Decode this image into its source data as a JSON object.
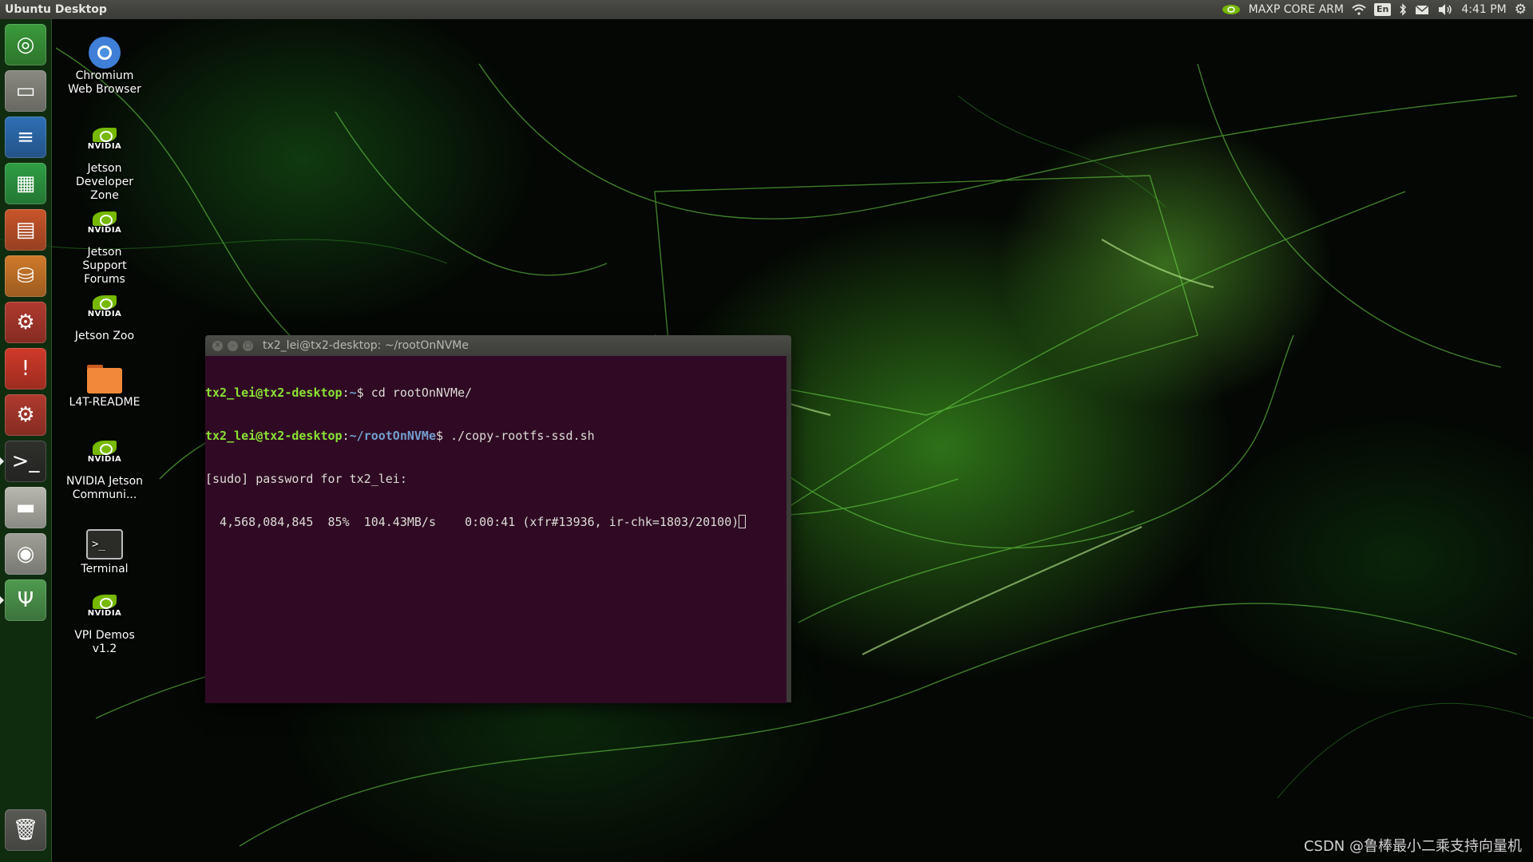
{
  "top_panel": {
    "title": "Ubuntu Desktop",
    "power_mode": "MAXP CORE ARM",
    "keyboard_lang": "En",
    "time": "4:41 PM",
    "icons": [
      "nvidia-icon",
      "wifi-icon",
      "keyboard-icon",
      "bluetooth-icon",
      "mail-icon",
      "volume-icon",
      "settings-gear-icon"
    ]
  },
  "launcher": {
    "items": [
      {
        "name": "ubuntu-dash",
        "glyph": "◎",
        "color": "#3b9b3b",
        "pip": false
      },
      {
        "name": "files",
        "glyph": "▭",
        "color": "#8a8a82",
        "pip": false
      },
      {
        "name": "libreoffice-writer",
        "glyph": "≡",
        "color": "#2e6fb5",
        "pip": false
      },
      {
        "name": "libreoffice-calc",
        "glyph": "▦",
        "color": "#2f9e44",
        "pip": false
      },
      {
        "name": "libreoffice-impress",
        "glyph": "▤",
        "color": "#c8552b",
        "pip": false
      },
      {
        "name": "software-center",
        "glyph": "⛁",
        "color": "#d07a2a",
        "pip": false
      },
      {
        "name": "system-settings",
        "glyph": "⚙",
        "color": "#b03a2e",
        "pip": false
      },
      {
        "name": "software-updater",
        "glyph": "!",
        "color": "#d03a2a",
        "pip": false
      },
      {
        "name": "system-settings-2",
        "glyph": "⚙",
        "color": "#b03a2e",
        "pip": false
      },
      {
        "name": "terminal",
        "glyph": ">_",
        "color": "#2f2f2c",
        "pip": true
      },
      {
        "name": "removable-drive",
        "glyph": "▬",
        "color": "#b8b8b0",
        "pip": false
      },
      {
        "name": "hard-drive",
        "glyph": "◉",
        "color": "#a0a098",
        "pip": false
      },
      {
        "name": "usb-drive",
        "glyph": "Ψ",
        "color": "#4f9a4f",
        "pip": true
      },
      {
        "name": "trash",
        "glyph": "🗑",
        "color": "#5a5a55",
        "pip": false
      }
    ]
  },
  "desktop": {
    "icons": [
      {
        "name": "chromium",
        "label": "Chromium Web Browser"
      },
      {
        "name": "jetson-developer-zone",
        "label": "Jetson Developer Zone"
      },
      {
        "name": "jetson-support-forums",
        "label": "Jetson Support Forums"
      },
      {
        "name": "jetson-zoo",
        "label": "Jetson Zoo"
      },
      {
        "name": "l4t-readme",
        "label": "L4T-README"
      },
      {
        "name": "nvidia-jetson-community",
        "label": "NVIDIA Jetson Communi..."
      },
      {
        "name": "terminal",
        "label": "Terminal"
      },
      {
        "name": "vpi-demos",
        "label": "VPI Demos v1.2"
      }
    ],
    "nvidia_word": "NVIDIA"
  },
  "terminal": {
    "title": "tx2_lei@tx2-desktop: ~/rootOnNVMe",
    "lines": [
      {
        "user": "tx2_lei@tx2-desktop",
        "path": "~",
        "prompt": "$ ",
        "cmd": "cd rootOnNVMe/"
      },
      {
        "user": "tx2_lei@tx2-desktop",
        "path": "~/rootOnNVMe",
        "prompt": "$ ",
        "cmd": "./copy-rootfs-ssd.sh"
      },
      {
        "text": "[sudo] password for tx2_lei:"
      },
      {
        "text": "  4,568,084,845  85%  104.43MB/s    0:00:41 (xfr#13936, ir-chk=1803/20100)"
      }
    ]
  },
  "watermark": "CSDN @鲁棒最小二乘支持向量机",
  "colors": {
    "terminal_bg": "#300a24",
    "prompt_user": "#8ae234",
    "prompt_path": "#729fcf",
    "nvidia_green": "#76b900"
  }
}
